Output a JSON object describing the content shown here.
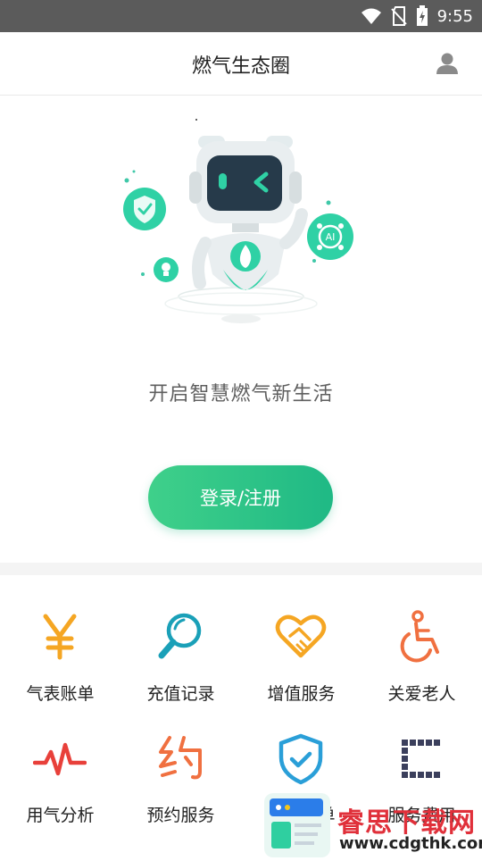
{
  "status_bar": {
    "time": "9:55",
    "icons": [
      "wifi-icon",
      "no-sim-icon",
      "battery-charging-icon"
    ]
  },
  "header": {
    "title": "燃气生态圈",
    "user_icon": "user-icon"
  },
  "hero": {
    "illustration": "robot-illustration",
    "robot_chest_icon": "flame-icon",
    "badges": [
      "shield-check-icon",
      "bulb-icon",
      "ai-network-icon"
    ],
    "badge_ai_text": "AI",
    "slogan": "开启智慧燃气新生活",
    "login_button": "登录/注册"
  },
  "services": [
    {
      "label": "气表账单",
      "icon": "yen-icon",
      "color": "#f5a623"
    },
    {
      "label": "充值记录",
      "icon": "magnifier-icon",
      "color": "#1aa0b8"
    },
    {
      "label": "增值服务",
      "icon": "heart-handshake-icon",
      "color": "#f5a623"
    },
    {
      "label": "关爱老人",
      "icon": "wheelchair-icon",
      "color": "#f07040"
    },
    {
      "label": "用气分析",
      "icon": "pulse-icon",
      "color": "#e8403a"
    },
    {
      "label": "预约服务",
      "icon": "yue-character-icon",
      "color": "#f07040"
    },
    {
      "label": "燃气账单",
      "icon": "shield-icon",
      "color": "#2a9fd8"
    },
    {
      "label": "服务费用",
      "icon": "bracket-icon",
      "color": "#3b3f5c"
    }
  ],
  "colors": {
    "accent": "#1fb985",
    "status_bar": "#5b5b5b"
  },
  "watermark": {
    "text": "睿思下载网",
    "url": "www.cdgthk.com"
  }
}
